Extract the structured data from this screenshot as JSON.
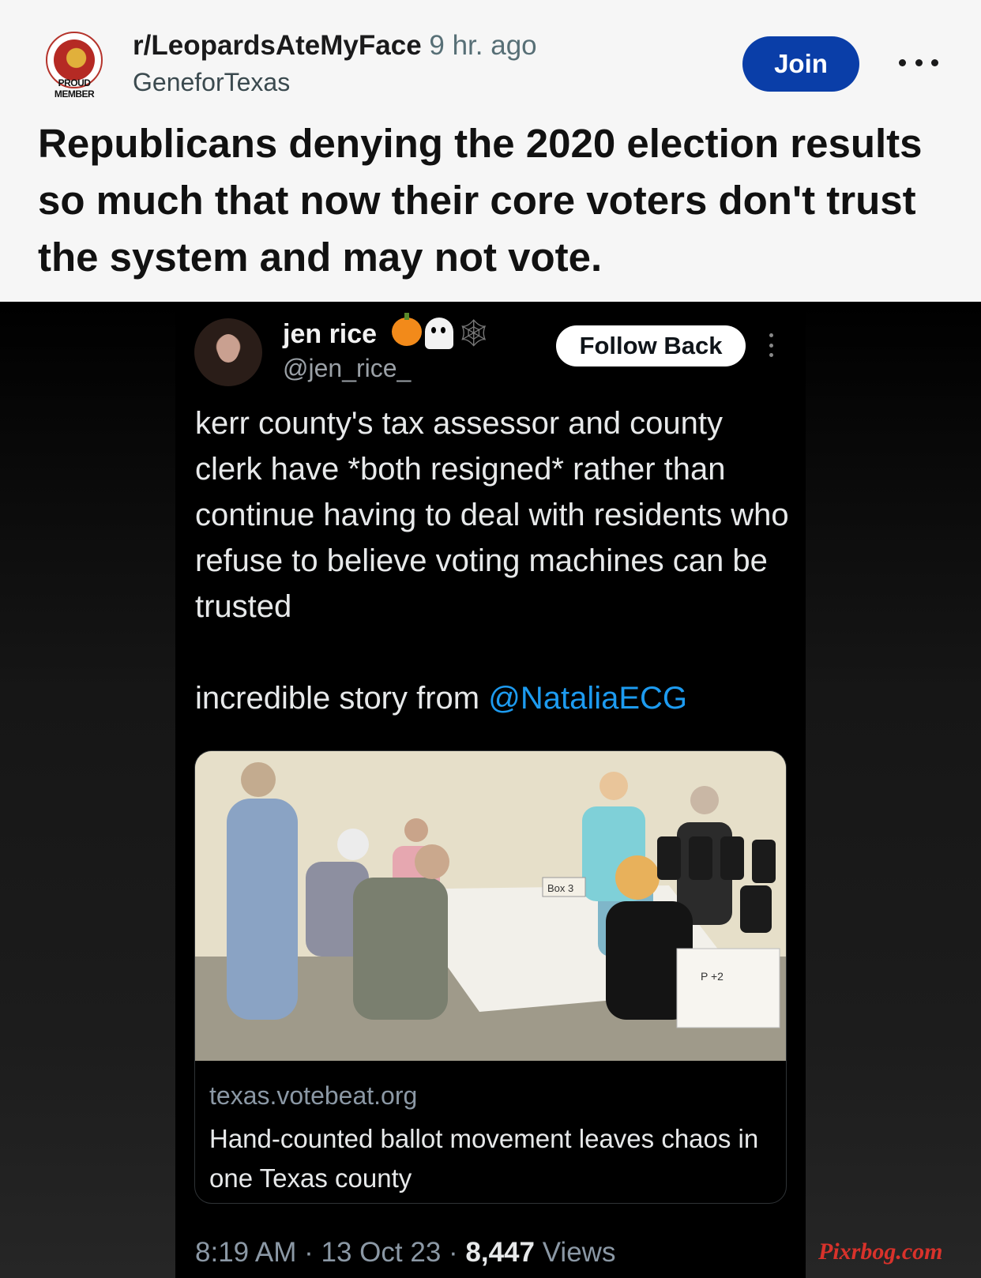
{
  "post": {
    "subreddit": "r/LeopardsAteMyFace",
    "time": "9 hr. ago",
    "author": "GeneforTexas",
    "join_label": "Join",
    "badge_text": "PROUD MEMBER",
    "title": "Republicans denying the 2020 election results so much that now their core voters don't trust the system and may not vote."
  },
  "tweet": {
    "name": "jen rice",
    "handle": "@jen_rice_",
    "emoji_icons": [
      "pumpkin-icon",
      "ghost-icon",
      "spider-web-icon"
    ],
    "spider_web_glyph": "🕸",
    "follow_label": "Follow Back",
    "body_line1": "kerr county's tax assessor and county clerk have *both resigned* rather than continue having to deal with residents who refuse to believe voting machines can be trusted",
    "body_line2_text": "incredible story from ",
    "body_line2_mention": "@NataliaECG",
    "card": {
      "domain": "texas.votebeat.org",
      "headline": "Hand-counted ballot movement leaves chaos in one Texas county",
      "image_labels": [
        "Box 3",
        "P +2"
      ]
    },
    "meta": {
      "time": "8:19 AM",
      "sep": " · ",
      "date": "13 Oct 23",
      "views_count": "8,447",
      "views_label": " Views"
    }
  },
  "watermark": "Pixrbog.com",
  "colors": {
    "join_bg": "#0a3ea8",
    "mention": "#1d9bf0",
    "watermark": "#d8322b"
  }
}
